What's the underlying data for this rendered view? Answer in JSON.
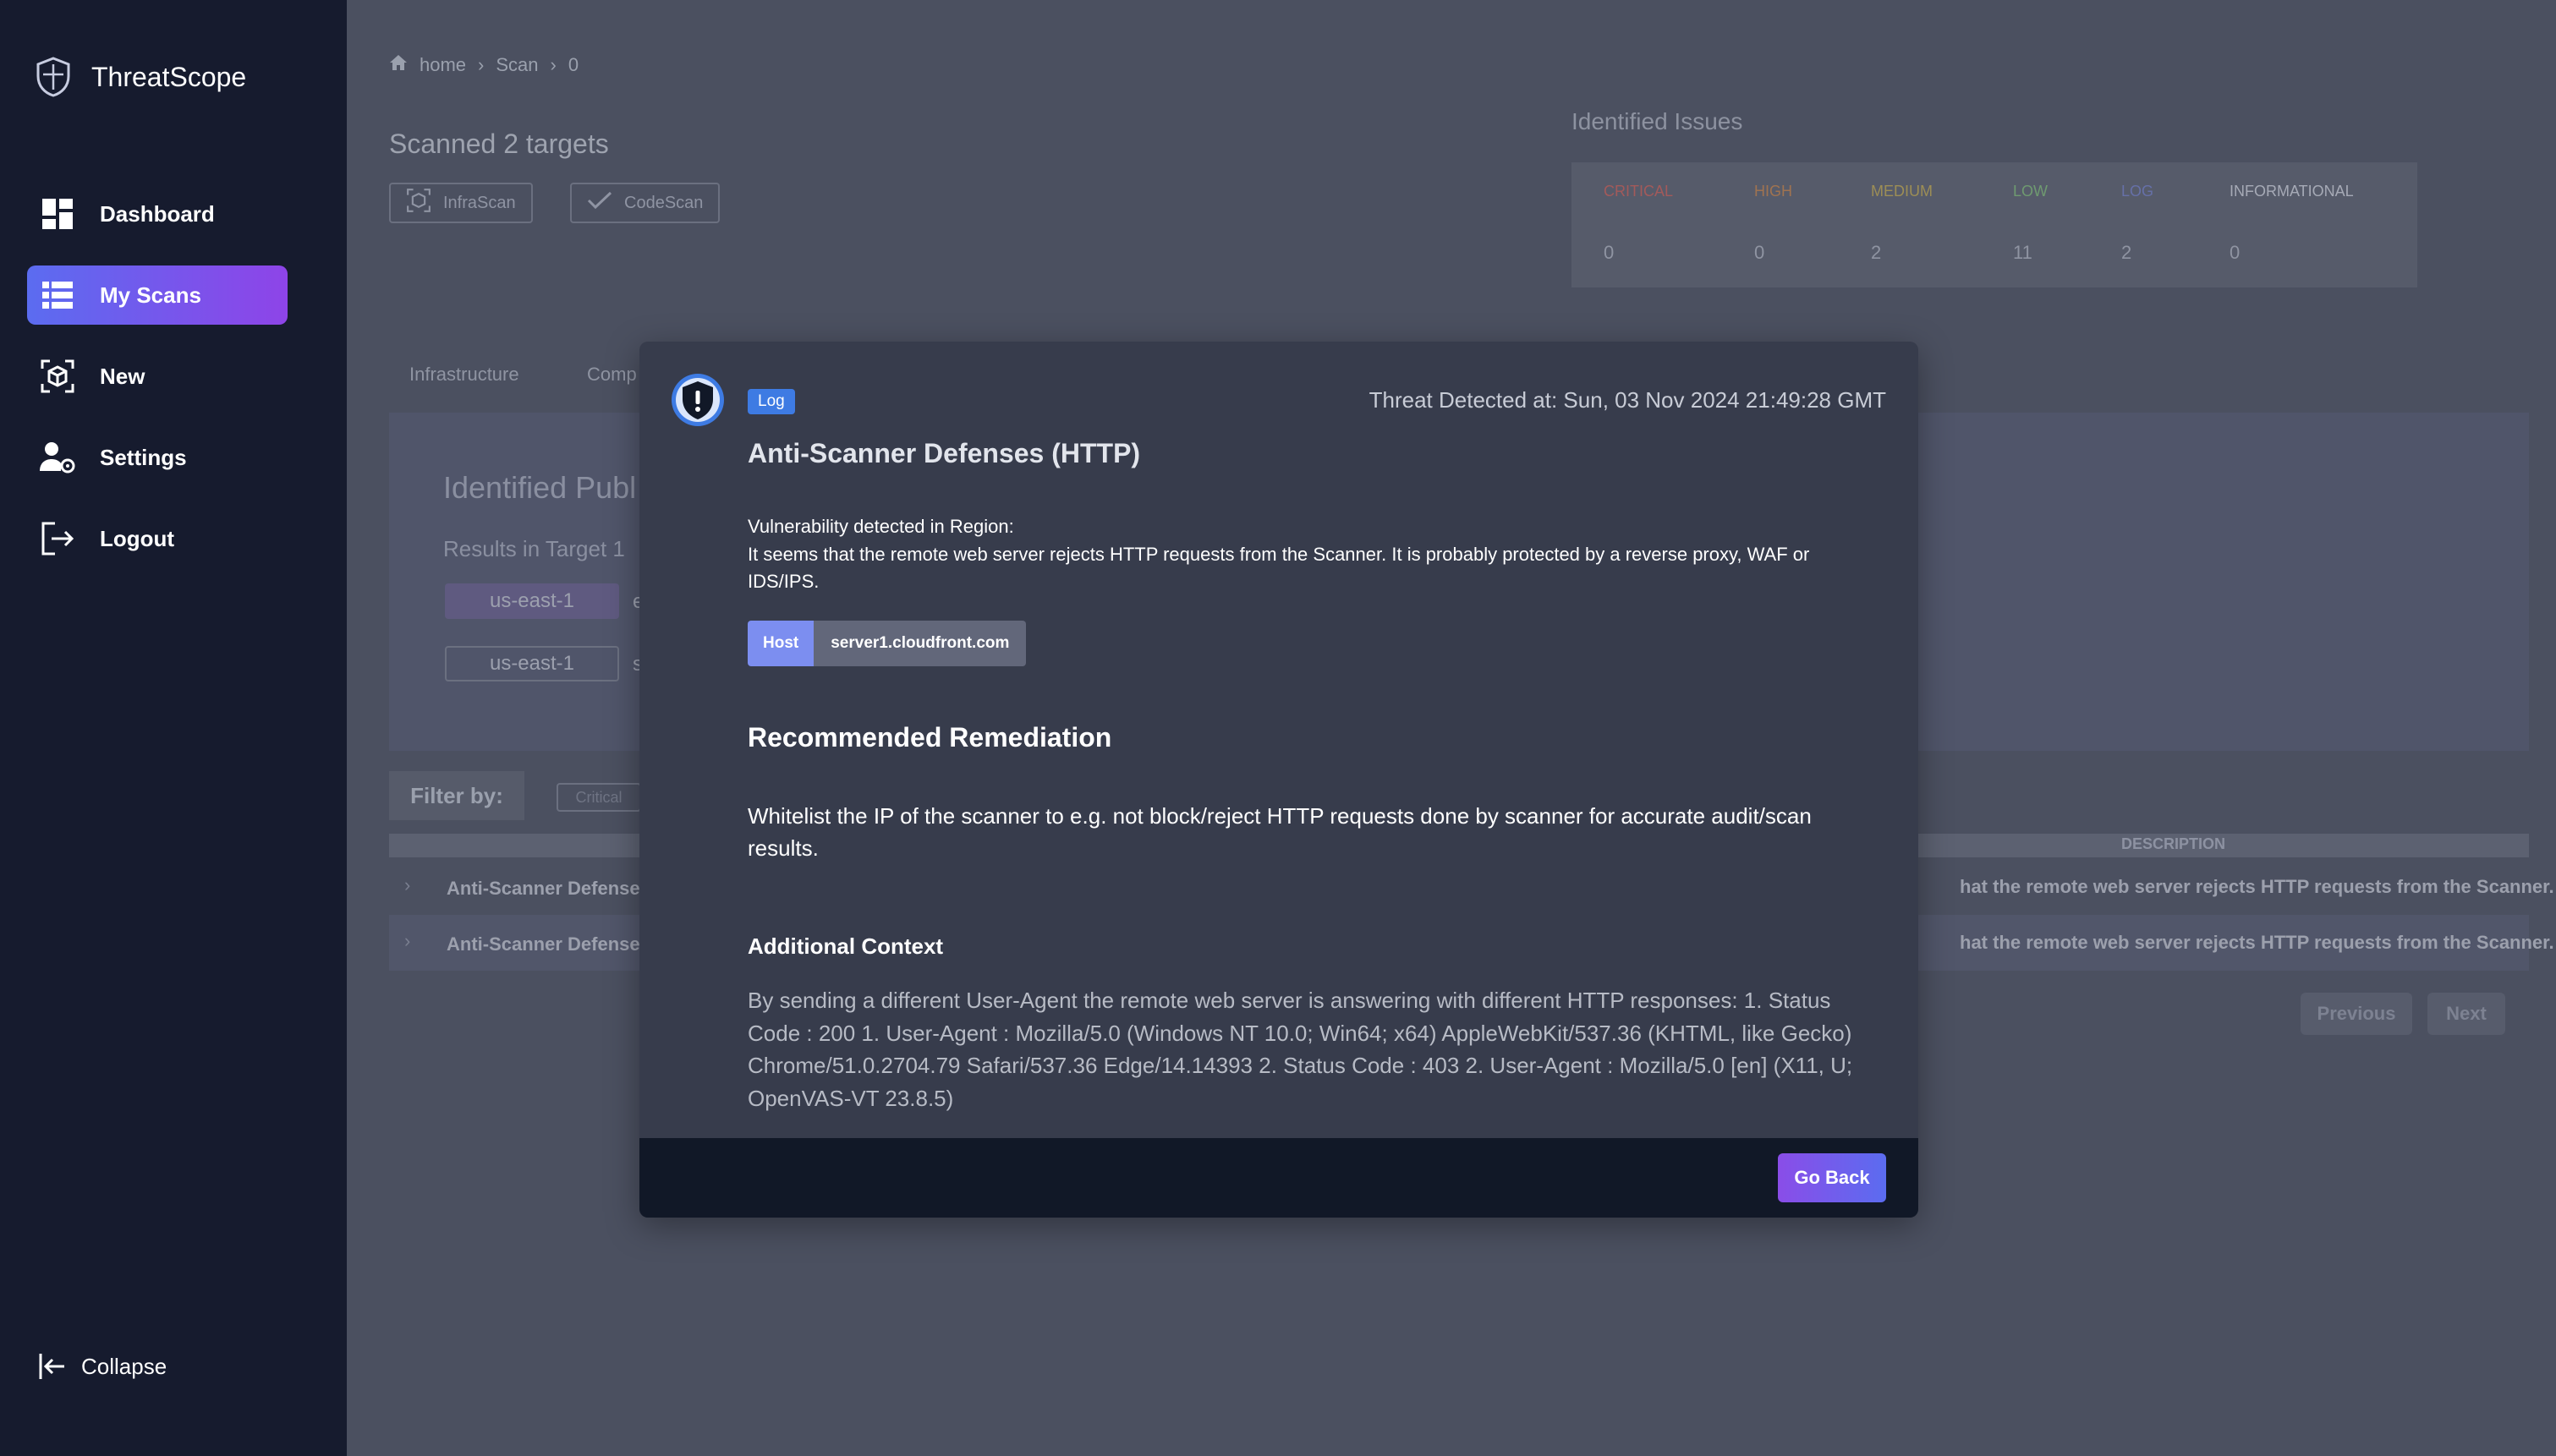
{
  "app": {
    "name": "ThreatScope"
  },
  "sidebar": {
    "items": [
      {
        "label": "Dashboard",
        "icon": "dashboard-icon"
      },
      {
        "label": "My Scans",
        "icon": "table-list-icon",
        "active": true
      },
      {
        "label": "New",
        "icon": "cube-scan-icon"
      },
      {
        "label": "Settings",
        "icon": "user-gear-icon"
      },
      {
        "label": "Logout",
        "icon": "logout-icon"
      }
    ],
    "collapse_label": "Collapse"
  },
  "breadcrumb": {
    "items": [
      "home",
      "Scan",
      "0"
    ]
  },
  "scan": {
    "title": "Scanned 2 targets",
    "chips": [
      {
        "label": "InfraScan",
        "icon": "cube-scan-icon"
      },
      {
        "label": "CodeScan",
        "icon": "check-icon"
      }
    ]
  },
  "issues": {
    "title": "Identified Issues",
    "columns": [
      {
        "label": "CRITICAL",
        "value": "0",
        "color": "#a35a5a"
      },
      {
        "label": "HIGH",
        "value": "0",
        "color": "#a07350"
      },
      {
        "label": "MEDIUM",
        "value": "2",
        "color": "#9d8e55"
      },
      {
        "label": "LOW",
        "value": "11",
        "color": "#6f9a70"
      },
      {
        "label": "LOG",
        "value": "2",
        "color": "#6670a8"
      },
      {
        "label": "INFORMATIONAL",
        "value": "0",
        "color": "#a6aab6"
      }
    ]
  },
  "tabs": {
    "infrastructure": "Infrastructure",
    "comp": "Comp"
  },
  "panel": {
    "title": "Identified Publ",
    "subtitle": "Results in Target 1",
    "regions": [
      "us-east-1",
      "us-east-1"
    ],
    "region_suffixes": [
      "e",
      "s"
    ]
  },
  "filter": {
    "label": "Filter by:",
    "critical": "Critical"
  },
  "results": {
    "description_header": "DESCRIPTION",
    "rows": [
      {
        "name": "Anti-Scanner Defense",
        "desc": "hat the remote web server rejects HTTP requests from the Scanner."
      },
      {
        "name": "Anti-Scanner Defense",
        "desc": "hat the remote web server rejects HTTP requests from the Scanner."
      }
    ],
    "previous": "Previous",
    "next": "Next"
  },
  "modal": {
    "badge": "Log",
    "detected_at": "Threat Detected at: Sun, 03 Nov 2024 21:49:28 GMT",
    "title": "Anti-Scanner Defenses (HTTP)",
    "region_label": "Vulnerability detected in Region:",
    "description": "It seems that the remote web server rejects HTTP requests from the Scanner. It is probably protected by a reverse proxy, WAF or IDS/IPS.",
    "host_key": "Host",
    "host_value": "server1.cloudfront.com",
    "remediation_title": "Recommended Remediation",
    "remediation_text": "Whitelist the IP of the scanner to e.g. not block/reject HTTP requests done by scanner for accurate audit/scan results.",
    "context_title": "Additional Context",
    "context_text": "By sending a different User-Agent the remote web server is answering with different HTTP responses: 1. Status Code : 200 1. User-Agent : Mozilla/5.0 (Windows NT 10.0; Win64; x64) AppleWebKit/537.36 (KHTML, like Gecko) Chrome/51.0.2704.79 Safari/537.36 Edge/14.14393 2. Status Code : 403 2. User-Agent : Mozilla/5.0 [en] (X11, U; OpenVAS-VT 23.8.5)",
    "go_back": "Go Back"
  },
  "colors": {
    "sidebar_bg": "#161b2e",
    "accent_start": "#5b6cf0",
    "accent_end": "#8e44e8",
    "modal_bg": "#373c4c",
    "log_badge": "#3e7be3"
  }
}
